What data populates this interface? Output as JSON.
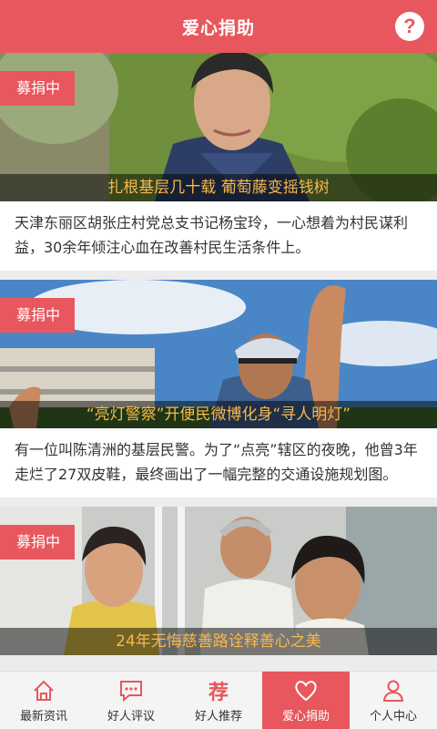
{
  "header": {
    "title": "爱心捐助",
    "help_icon": "?"
  },
  "colors": {
    "accent": "#e8575d",
    "caption": "#f7b94a"
  },
  "cards": [
    {
      "badge": "募捐中",
      "caption": "扎根基层几十载 葡萄藤变摇钱树",
      "desc": "天津东丽区胡张庄村党总支书记杨宝玲，一心想着为村民谋利益，30余年倾注心血在改善村民生活条件上。"
    },
    {
      "badge": "募捐中",
      "caption": "“亮灯警察”开便民微博化身“寻人明灯”",
      "desc": "有一位叫陈清洲的基层民警。为了“点亮”辖区的夜晚，他曾3年走烂了27双皮鞋，最终画出了一幅完整的交通设施规划图。"
    },
    {
      "badge": "募捐中",
      "caption": "24年无悔慈善路诠释善心之美",
      "desc": ""
    }
  ],
  "tabs": [
    {
      "label": "最新资讯",
      "icon": "home-icon"
    },
    {
      "label": "好人评议",
      "icon": "comment-icon"
    },
    {
      "label": "好人推荐",
      "icon": "recommend-icon",
      "glyph": "荐"
    },
    {
      "label": "爱心捐助",
      "icon": "heart-icon",
      "active": true
    },
    {
      "label": "个人中心",
      "icon": "person-icon"
    }
  ]
}
